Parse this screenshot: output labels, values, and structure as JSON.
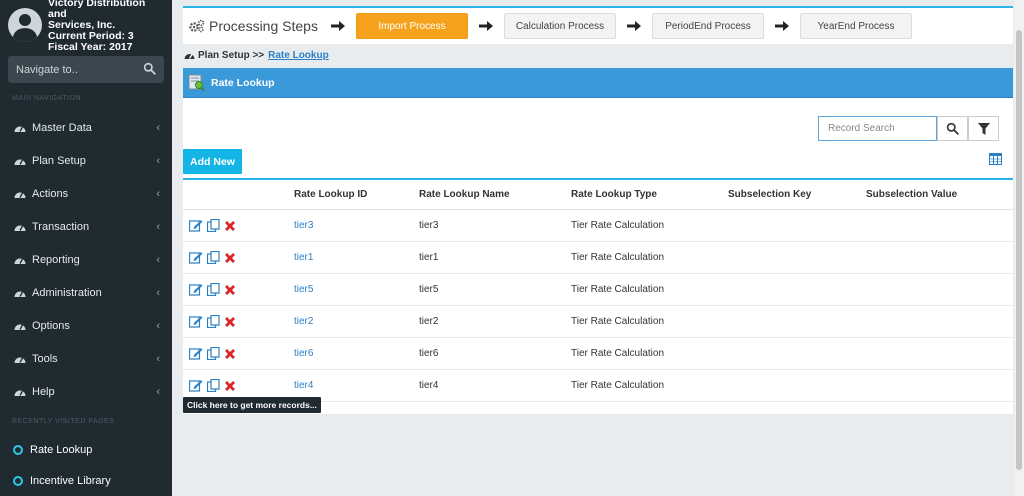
{
  "profile": {
    "company_line1": "Victory Distribution and",
    "company_line2": "Services, Inc.",
    "current_period": "Current Period: 3",
    "fiscal_year": "Fiscal Year: 2017"
  },
  "sidebar": {
    "search_placeholder": "Navigate to..",
    "section_label": "MAIN NAVIGATION",
    "items": [
      {
        "label": "Master Data"
      },
      {
        "label": "Plan Setup"
      },
      {
        "label": "Actions"
      },
      {
        "label": "Transaction"
      },
      {
        "label": "Reporting"
      },
      {
        "label": "Administration"
      },
      {
        "label": "Options"
      },
      {
        "label": "Tools"
      },
      {
        "label": "Help"
      }
    ],
    "recent_label": "RECENTLY VISITED PAGES",
    "recent": [
      {
        "label": "Rate Lookup"
      },
      {
        "label": "Incentive Library"
      }
    ]
  },
  "steps": {
    "title": "Processing Steps",
    "items": [
      {
        "label": "Import Process",
        "active": true
      },
      {
        "label": "Calculation Process",
        "active": false
      },
      {
        "label": "PeriodEnd Process",
        "active": false
      },
      {
        "label": "YearEnd Process",
        "active": false
      }
    ]
  },
  "breadcrumb": {
    "parent": "Plan Setup >>",
    "current": "Rate Lookup"
  },
  "page": {
    "title": "Rate Lookup",
    "search_placeholder": "Record Search",
    "add_label": "Add New",
    "more_label": "Click here to get more records..."
  },
  "table": {
    "columns": [
      "Rate Lookup ID",
      "Rate Lookup Name",
      "Rate Lookup Type",
      "Subselection Key",
      "Subselection Value"
    ],
    "rows": [
      {
        "id": "tier3",
        "name": "tier3",
        "type": "Tier Rate Calculation",
        "key": "",
        "value": ""
      },
      {
        "id": "tier1",
        "name": "tier1",
        "type": "Tier Rate Calculation",
        "key": "",
        "value": ""
      },
      {
        "id": "tier5",
        "name": "tier5",
        "type": "Tier Rate Calculation",
        "key": "",
        "value": ""
      },
      {
        "id": "tier2",
        "name": "tier2",
        "type": "Tier Rate Calculation",
        "key": "",
        "value": ""
      },
      {
        "id": "tier6",
        "name": "tier6",
        "type": "Tier Rate Calculation",
        "key": "",
        "value": ""
      },
      {
        "id": "tier4",
        "name": "tier4",
        "type": "Tier Rate Calculation",
        "key": "",
        "value": ""
      }
    ]
  },
  "colors": {
    "sidebar_bg": "#1f2a31",
    "accent_blue": "#29b6e6",
    "title_bar": "#3a9ad9",
    "active_step": "#f7a21c",
    "delete_red": "#d9262b"
  }
}
